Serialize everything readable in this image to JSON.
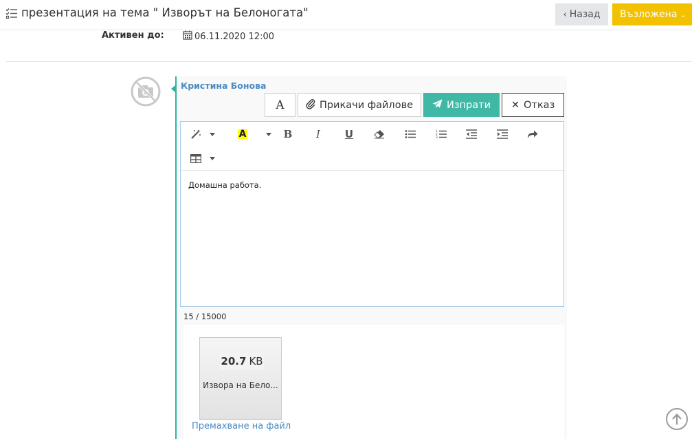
{
  "header": {
    "title": "презентация на тема \" Изворът на Белоногата\"",
    "title_icon": "tasks-list-icon",
    "back_label": "Назад",
    "status_label": "Възложена"
  },
  "details": {
    "active_until_label": "Активен до:",
    "active_until_value": "06.11.2020 12:00"
  },
  "comment": {
    "author": "Кристина Бонова",
    "font_button_label": "A",
    "attach_label": "Прикачи файлове",
    "send_label": "Изпрати",
    "cancel_label": "Отказ",
    "editor_content": "Домашна работа.",
    "char_counter": "15 / 15000"
  },
  "attachment": {
    "size_value": "20.7",
    "size_unit": "KB",
    "file_name": "Извора на Бело...",
    "remove_label": "Премахване на файл"
  },
  "colors": {
    "teal": "#3fb8a6",
    "status_yellow": "#f2c100",
    "link_blue": "#4a8bc2"
  }
}
